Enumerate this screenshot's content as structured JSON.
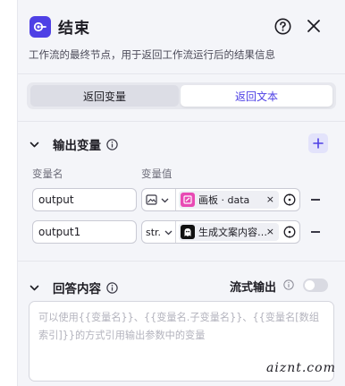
{
  "header": {
    "title": "结束",
    "description": "工作流的最终节点，用于返回工作流运行后的结果信息"
  },
  "tabs": {
    "left": "返回变量",
    "right": "返回文本",
    "active": "返回文本"
  },
  "output_section": {
    "title": "输出变量",
    "col_name": "变量名",
    "col_value": "变量值",
    "rows": [
      {
        "name": "output",
        "type_icon": "image-icon",
        "ref_label": "画板 · data",
        "ref_icon": "board-icon",
        "ref_color": "#e84ab4"
      },
      {
        "name": "output1",
        "type_text": "str.",
        "ref_label": "生成文案内容 · outp",
        "ref_icon": "ghost-icon",
        "ref_color": "#111111"
      }
    ]
  },
  "answer_section": {
    "title": "回答内容",
    "stream_label": "流式输出",
    "stream_enabled": false,
    "placeholder": "可以使用{{变量名}}、{{变量名.子变量名}}、{{变量名[数组索引]}}的方式引用输出参数中的变量"
  },
  "watermark": "aiznt.com",
  "colors": {
    "accent": "#4e40e5",
    "panel_bg": "#f4f5f9"
  }
}
